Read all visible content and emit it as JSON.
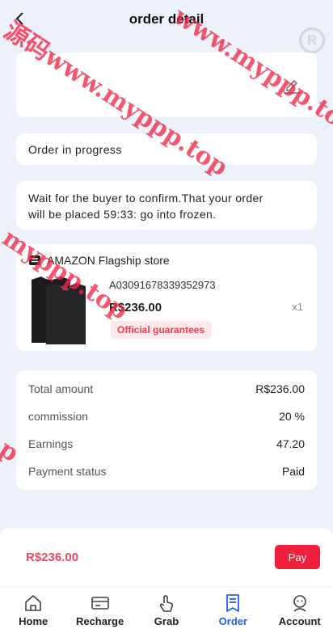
{
  "header": {
    "title": "order detail"
  },
  "status": {
    "text": "Order in progress"
  },
  "notice": {
    "line1": "Wait for the buyer to confirm.That your order",
    "line2": "will be placed 59:33: go into frozen."
  },
  "store": {
    "name": "AMAZON Flagship store",
    "order_no": "A03091678339352973",
    "price": "R$236.00",
    "qty": "x1",
    "badge": "Official guarantees"
  },
  "summary": {
    "rows": [
      {
        "label": "Total amount",
        "value": "R$236.00"
      },
      {
        "label": "commission",
        "value": "20 %"
      },
      {
        "label": "Earnings",
        "value": "47.20"
      },
      {
        "label": "Payment status",
        "value": "Paid"
      }
    ]
  },
  "paybar": {
    "amount": "R$236.00",
    "button_label": "Pay"
  },
  "tabs": [
    {
      "label": "Home",
      "icon": "home-icon"
    },
    {
      "label": "Recharge",
      "icon": "card-icon"
    },
    {
      "label": "Grab",
      "icon": "hand-tap-icon"
    },
    {
      "label": "Order",
      "icon": "order-icon",
      "active": true
    },
    {
      "label": "Account",
      "icon": "user-icon"
    }
  ],
  "colors": {
    "accent": "#2461e6",
    "price_red": "#ea4a5e",
    "button_red": "#f0213d",
    "background": "#edf1fa"
  },
  "watermark": {
    "lines": [
      "源码www.myppp.top",
      "www.myppp.top",
      "myppp.top",
      "p"
    ]
  }
}
